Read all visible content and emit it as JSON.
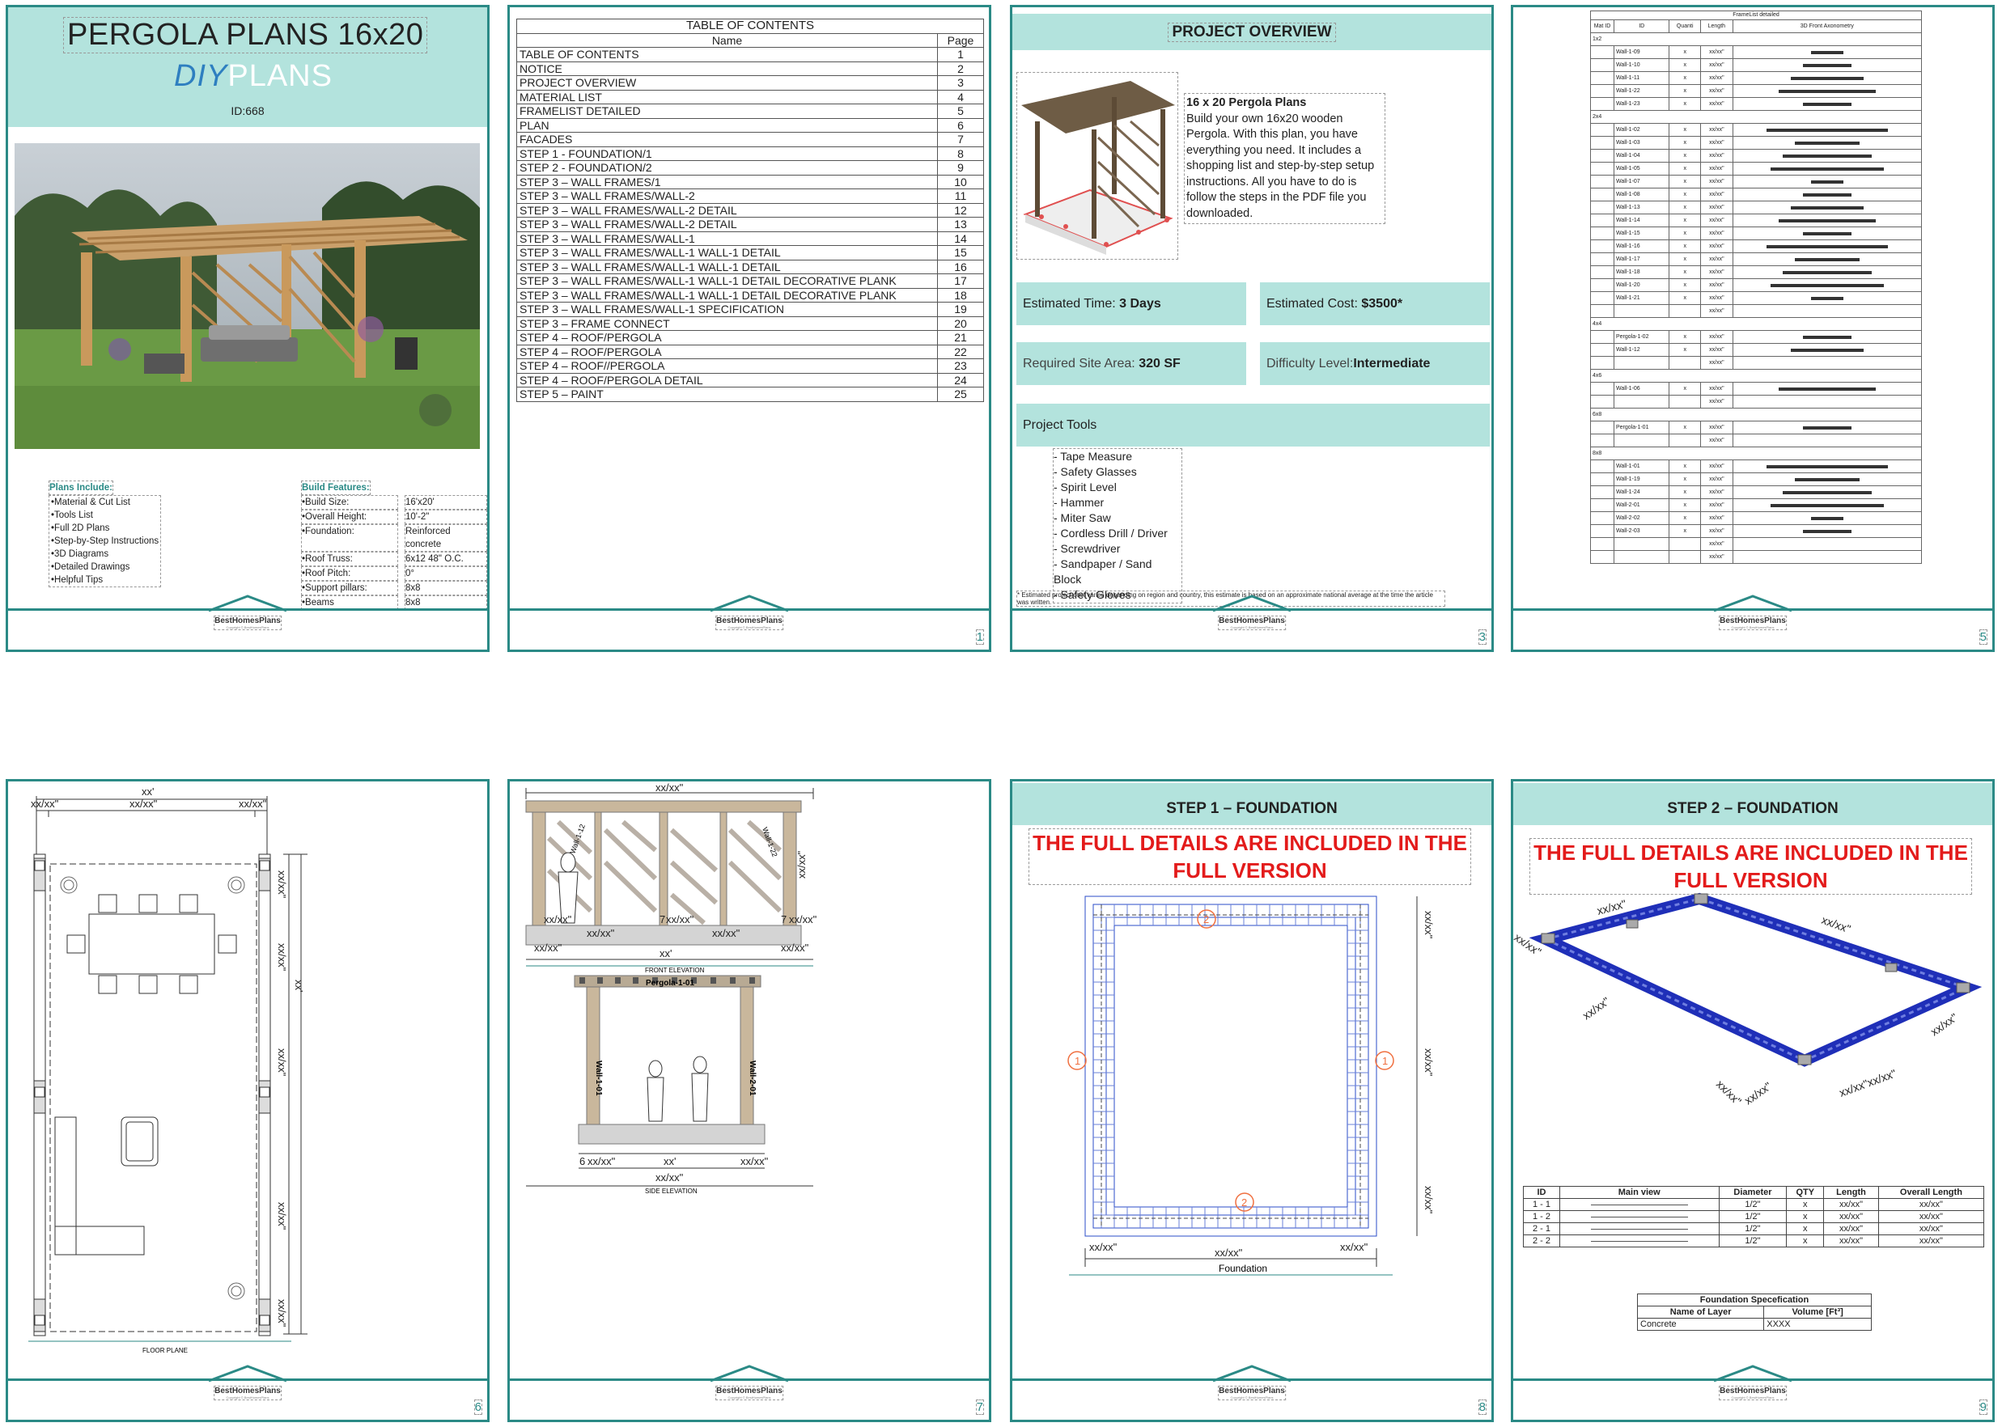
{
  "brand": {
    "name": "BestHomesPlans",
    "copyright": "Copyright © BestHomesPlans"
  },
  "cover": {
    "title": "PERGOLA PLANS 16x20",
    "brand_diy": "DIY",
    "brand_plans": "PLANS",
    "id": "ID:668",
    "plans_include_title": "Plans Include:",
    "plans_include": [
      "Material & Cut List",
      "Tools List",
      "Full 2D Plans",
      "Step-by-Step Instructions",
      "3D Diagrams",
      "Detailed Drawings",
      "Helpful Tips"
    ],
    "build_features_title": "Build Features:",
    "features": [
      {
        "k": "Build Size:",
        "v": "16'x20'"
      },
      {
        "k": "Overall Height:",
        "v": "10'-2\""
      },
      {
        "k": "Foundation:",
        "v": "Reinforced concrete"
      },
      {
        "k": "Roof Truss:",
        "v": "6x12 48\" O.C."
      },
      {
        "k": "Roof Pitch:",
        "v": "0°"
      },
      {
        "k": "Support pillars:",
        "v": "8x8"
      },
      {
        "k": "Beams",
        "v": "8x8"
      }
    ]
  },
  "toc": {
    "title": "TABLE OF CONTENTS",
    "col_name": "Name",
    "col_page": "Page",
    "page_number": "1",
    "rows": [
      {
        "name": "TABLE OF CONTENTS",
        "page": "1"
      },
      {
        "name": "NOTICE",
        "page": "2"
      },
      {
        "name": "PROJECT OVERVIEW",
        "page": "3"
      },
      {
        "name": "MATERIAL LIST",
        "page": "4"
      },
      {
        "name": "FRAMELIST DETAILED",
        "page": "5"
      },
      {
        "name": "PLAN",
        "page": "6"
      },
      {
        "name": "FACADES",
        "page": "7"
      },
      {
        "name": "STEP 1 - FOUNDATION/1",
        "page": "8"
      },
      {
        "name": "STEP 2 - FOUNDATION/2",
        "page": "9"
      },
      {
        "name": "STEP 3 – WALL FRAMES/1",
        "page": "10"
      },
      {
        "name": "STEP 3 – WALL FRAMES/WALL-2",
        "page": "11"
      },
      {
        "name": "STEP 3 – WALL FRAMES/WALL-2 DETAIL",
        "page": "12"
      },
      {
        "name": "STEP 3 – WALL FRAMES/WALL-2 DETAIL",
        "page": "13"
      },
      {
        "name": "STEP 3 – WALL FRAMES/WALL-1",
        "page": "14"
      },
      {
        "name": "STEP 3 – WALL FRAMES/WALL-1 WALL-1 DETAIL",
        "page": "15"
      },
      {
        "name": "STEP 3 – WALL FRAMES/WALL-1 WALL-1 DETAIL",
        "page": "16"
      },
      {
        "name": "STEP 3 – WALL FRAMES/WALL-1 WALL-1 DETAIL DECORATIVE PLANK",
        "page": "17"
      },
      {
        "name": "STEP 3 – WALL FRAMES/WALL-1 WALL-1 DETAIL DECORATIVE PLANK",
        "page": "18"
      },
      {
        "name": "STEP 3 – WALL FRAMES/WALL-1 SPECIFICATION",
        "page": "19"
      },
      {
        "name": "STEP 3 – FRAME CONNECT",
        "page": "20"
      },
      {
        "name": "STEP 4 – ROOF/PERGOLA",
        "page": "21"
      },
      {
        "name": "STEP 4 – ROOF/PERGOLA",
        "page": "22"
      },
      {
        "name": "STEP 4 – ROOF//PERGOLA",
        "page": "23"
      },
      {
        "name": "STEP 4 – ROOF/PERGOLA DETAIL",
        "page": "24"
      },
      {
        "name": "STEP 5 – PAINT",
        "page": "25"
      }
    ]
  },
  "overview": {
    "header": "PROJECT OVERVIEW",
    "page_number": "3",
    "desc_title": "16 x 20 Pergola Plans",
    "desc": "Build your own 16x20 wooden Pergola. With this plan, you have everything you need. It includes a shopping list and step-by-step setup instructions. All you have to do is follow the steps in the PDF file you downloaded.",
    "time_label": "Estimated Time: ",
    "time_value": "3 Days",
    "cost_label": "Estimated Cost: ",
    "cost_value": "$3500*",
    "area_label": "Required Site Area: ",
    "area_value": "320 SF",
    "difficulty_label": "Difficulty Level:",
    "difficulty_value": "Intermediate",
    "tools_header": "Project Tools",
    "tools": [
      "- Tape Measure",
      "- Safety Glasses",
      "- Spirit Level",
      "- Hammer",
      "- Miter Saw",
      "- Cordless Drill / Driver",
      "- Screwdriver",
      "- Sandpaper / Sand Block",
      "- Safety Gloves"
    ],
    "footnote": "* Estimated project cost varies depending on region and country, this estimate is based on an approximate national average at the time the article was written."
  },
  "framelist": {
    "title": "FrameList detailed",
    "page_number": "5",
    "headers": [
      "Mat ID",
      "ID",
      "Quanti",
      "Length",
      "3D Front Axonometry"
    ],
    "groups": [
      {
        "mat": "1x2",
        "ids": [
          "Wall-1-09",
          "Wall-1-10",
          "Wall-1-11",
          "Wall-1-22",
          "Wall-1-23"
        ]
      },
      {
        "mat": "2x4",
        "ids": [
          "Wall-1-02",
          "Wall-1-03",
          "Wall-1-04",
          "Wall-1-05",
          "Wall-1-07",
          "Wall-1-08",
          "Wall-1-13",
          "Wall-1-14",
          "Wall-1-15",
          "Wall-1-16",
          "Wall-1-17",
          "Wall-1-18",
          "Wall-1-20",
          "Wall-1-21",
          ""
        ]
      },
      {
        "mat": "4x4",
        "ids": [
          "Pergola-1-02",
          "Wall-1-12",
          ""
        ]
      },
      {
        "mat": "4x6",
        "ids": [
          "Wall-1-06",
          ""
        ]
      },
      {
        "mat": "6x8",
        "ids": [
          "Pergola-1-01",
          ""
        ]
      },
      {
        "mat": "8x8",
        "ids": [
          "Wall-1-01",
          "Wall-1-19",
          "Wall-1-24",
          "Wall-2-01",
          "Wall-2-02",
          "Wall-2-03",
          "",
          ""
        ]
      }
    ],
    "qty": "x",
    "len": "xx/xx\""
  },
  "plan": {
    "page_number": "6",
    "caption": "FLOOR PLANE",
    "dim_top": "xx'",
    "dim_a": "xx/xx\"",
    "dim_b": "xx/xx\"",
    "dim_c": "xx/xx\"",
    "dim_side": "xx'",
    "dim_right": [
      "xx/xx\"",
      "xx/xx\"",
      "xx/xx\"",
      "xx/xx\"",
      "xx/xx\""
    ]
  },
  "facades": {
    "page_number": "7",
    "front_caption": "FRONT ELEVATION",
    "side_caption": "SIDE ELEVATION",
    "dim_top": "xx/xx\"",
    "dim_xx": "xx'",
    "dim": "xx/xx\"",
    "beam_label": "Pergola-1-01",
    "post_left": "Wall-1-01",
    "post_right": "Wall-2-01",
    "wall_label_left": "Wall-1-12",
    "wall_label_right": "Wall-1-22",
    "small_7": "7",
    "small_6": "6"
  },
  "step1": {
    "header": "STEP 1 – FOUNDATION",
    "notice": "THE FULL DETAILS ARE INCLUDED IN THE FULL VERSION",
    "page_number": "8",
    "caption": "Foundation",
    "dim": "xx/xx\"",
    "m1": "1",
    "m2": "2"
  },
  "step2": {
    "header": "STEP 2 – FOUNDATION",
    "notice": "THE FULL DETAILS ARE INCLUDED IN THE FULL VERSION",
    "page_number": "9",
    "dim": "xx/xx\"",
    "dim_long": "xx/xx\"xx/xx\"",
    "table_headers": [
      "ID",
      "Main view",
      "Diameter",
      "QTY",
      "Length",
      "Overall Length"
    ],
    "table_rows": [
      {
        "id": "1 - 1",
        "d": "1/2\"",
        "q": "x",
        "l": "xx/xx\"",
        "o": "xx/xx\""
      },
      {
        "id": "1 - 2",
        "d": "1/2\"",
        "q": "x",
        "l": "xx/xx\"",
        "o": "xx/xx\""
      },
      {
        "id": "2 - 1",
        "d": "1/2\"",
        "q": "x",
        "l": "xx/xx\"",
        "o": "xx/xx\""
      },
      {
        "id": "2 - 2",
        "d": "1/2\"",
        "q": "x",
        "l": "xx/xx\"",
        "o": "xx/xx\""
      }
    ],
    "spec_title": "Foundation Specefication",
    "spec_col1": "Name of Layer",
    "spec_col2": "Volume [Ft³]",
    "spec_layer": "Concrete",
    "spec_volume": "XXXX"
  },
  "colors": {
    "teal": "#2b8a86",
    "teal_light": "#b3e3dd",
    "red": "#e31b1b",
    "blue": "#2e7fc0"
  }
}
